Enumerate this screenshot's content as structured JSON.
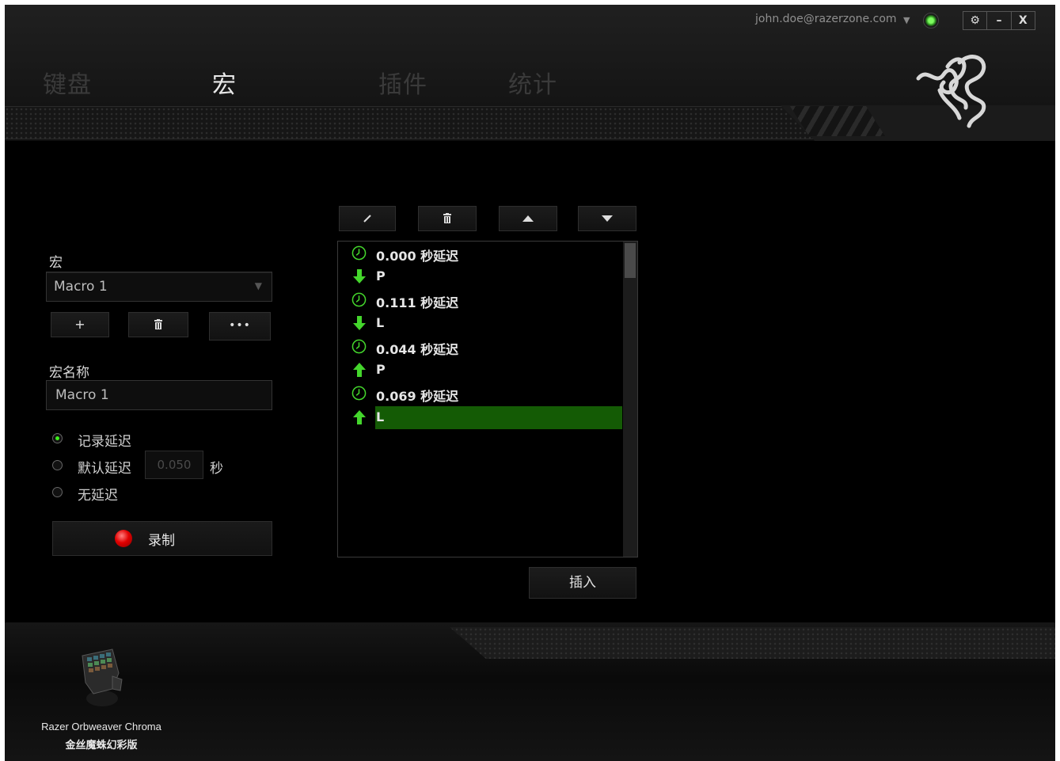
{
  "header": {
    "tabs": [
      {
        "label": "键盘",
        "active": false
      },
      {
        "label": "宏",
        "active": true
      },
      {
        "label": "插件",
        "active": false
      },
      {
        "label": "统计",
        "active": false
      }
    ],
    "account_email": "john.doe@razerzone.com",
    "window_buttons": {
      "settings": "⚙",
      "minimize": "–",
      "close": "X"
    }
  },
  "macro_panel": {
    "macro_label": "宏",
    "selected_macro": "Macro 1",
    "add_button": "+",
    "more_button": "•••",
    "name_label": "宏名称",
    "name_value": "Macro 1",
    "delay_options": {
      "record": "记录延迟",
      "default": "默认延迟",
      "default_value": "0.050",
      "default_unit": "秒",
      "none": "无延迟",
      "selected": "record"
    },
    "record_button": "录制"
  },
  "event_list": {
    "rows": [
      {
        "type": "delay",
        "text": "0.000 秒延迟"
      },
      {
        "type": "keydown",
        "text": "P"
      },
      {
        "type": "delay",
        "text": "0.111 秒延迟"
      },
      {
        "type": "keydown",
        "text": "L"
      },
      {
        "type": "delay",
        "text": "0.044 秒延迟"
      },
      {
        "type": "keyup",
        "text": "P"
      },
      {
        "type": "delay",
        "text": "0.069 秒延迟"
      },
      {
        "type": "keyup",
        "text": "L",
        "selected": true
      }
    ],
    "insert_button": "插入"
  },
  "device": {
    "name_en": "Razer Orbweaver Chroma",
    "name_zh": "金丝魔蛛幻彩版"
  },
  "colors": {
    "accent_green": "#44d62c",
    "selected_row": "#145b05",
    "record_red": "#e00000"
  }
}
